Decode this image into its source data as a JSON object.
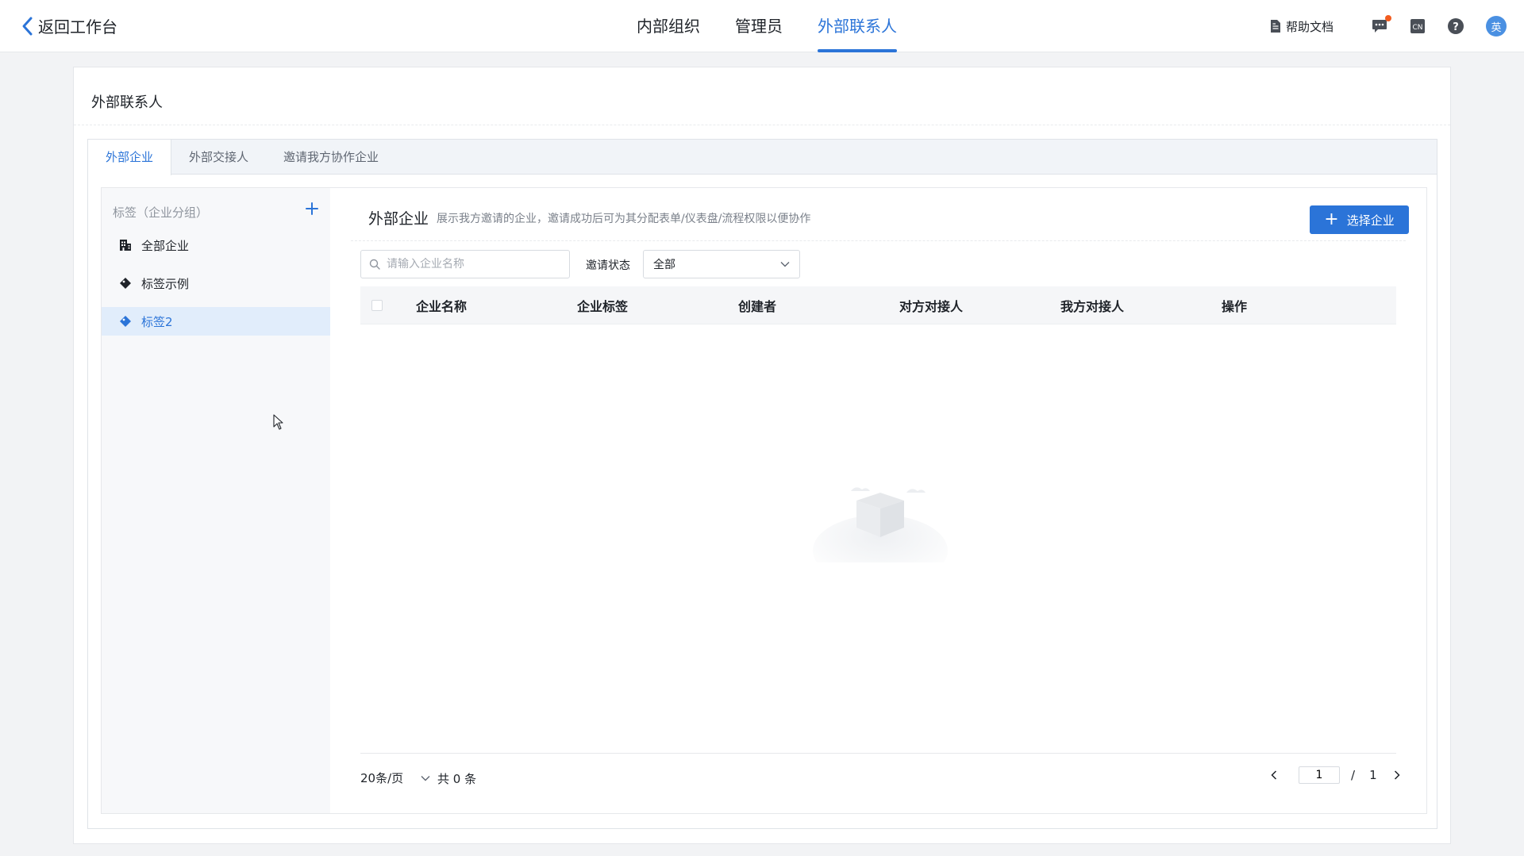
{
  "header": {
    "back_label": "返回工作台",
    "nav": [
      {
        "label": "内部组织",
        "active": false
      },
      {
        "label": "管理员",
        "active": false
      },
      {
        "label": "外部联系人",
        "active": true
      }
    ],
    "help_doc_label": "帮助文档",
    "lang_icon_text": "CN",
    "help_icon_text": "?",
    "avatar_text": "英",
    "accent_color": "#2b74d8"
  },
  "page": {
    "title": "外部联系人",
    "tabs": [
      {
        "label": "外部企业",
        "active": true
      },
      {
        "label": "外部交接人",
        "active": false
      },
      {
        "label": "邀请我方协作企业",
        "active": false
      }
    ]
  },
  "sidebar": {
    "heading": "标签（企业分组）",
    "items": [
      {
        "label": "全部企业",
        "icon": "building-icon",
        "active": false
      },
      {
        "label": "标签示例",
        "icon": "tag-icon",
        "active": false
      },
      {
        "label": "标签2",
        "icon": "tag-icon",
        "active": true
      }
    ]
  },
  "main": {
    "title": "外部企业",
    "description": "展示我方邀请的企业，邀请成功后可为其分配表单/仪表盘/流程权限以便协作",
    "select_button": "选择企业",
    "search_placeholder": "请输入企业名称",
    "status_label": "邀请状态",
    "status_value": "全部",
    "columns": [
      "企业名称",
      "企业标签",
      "创建者",
      "对方对接人",
      "我方对接人",
      "操作"
    ],
    "rows": []
  },
  "pagination": {
    "page_size": "20条/页",
    "total": "共 0 条",
    "current_page": "1",
    "separator": "/",
    "total_pages": "1"
  }
}
